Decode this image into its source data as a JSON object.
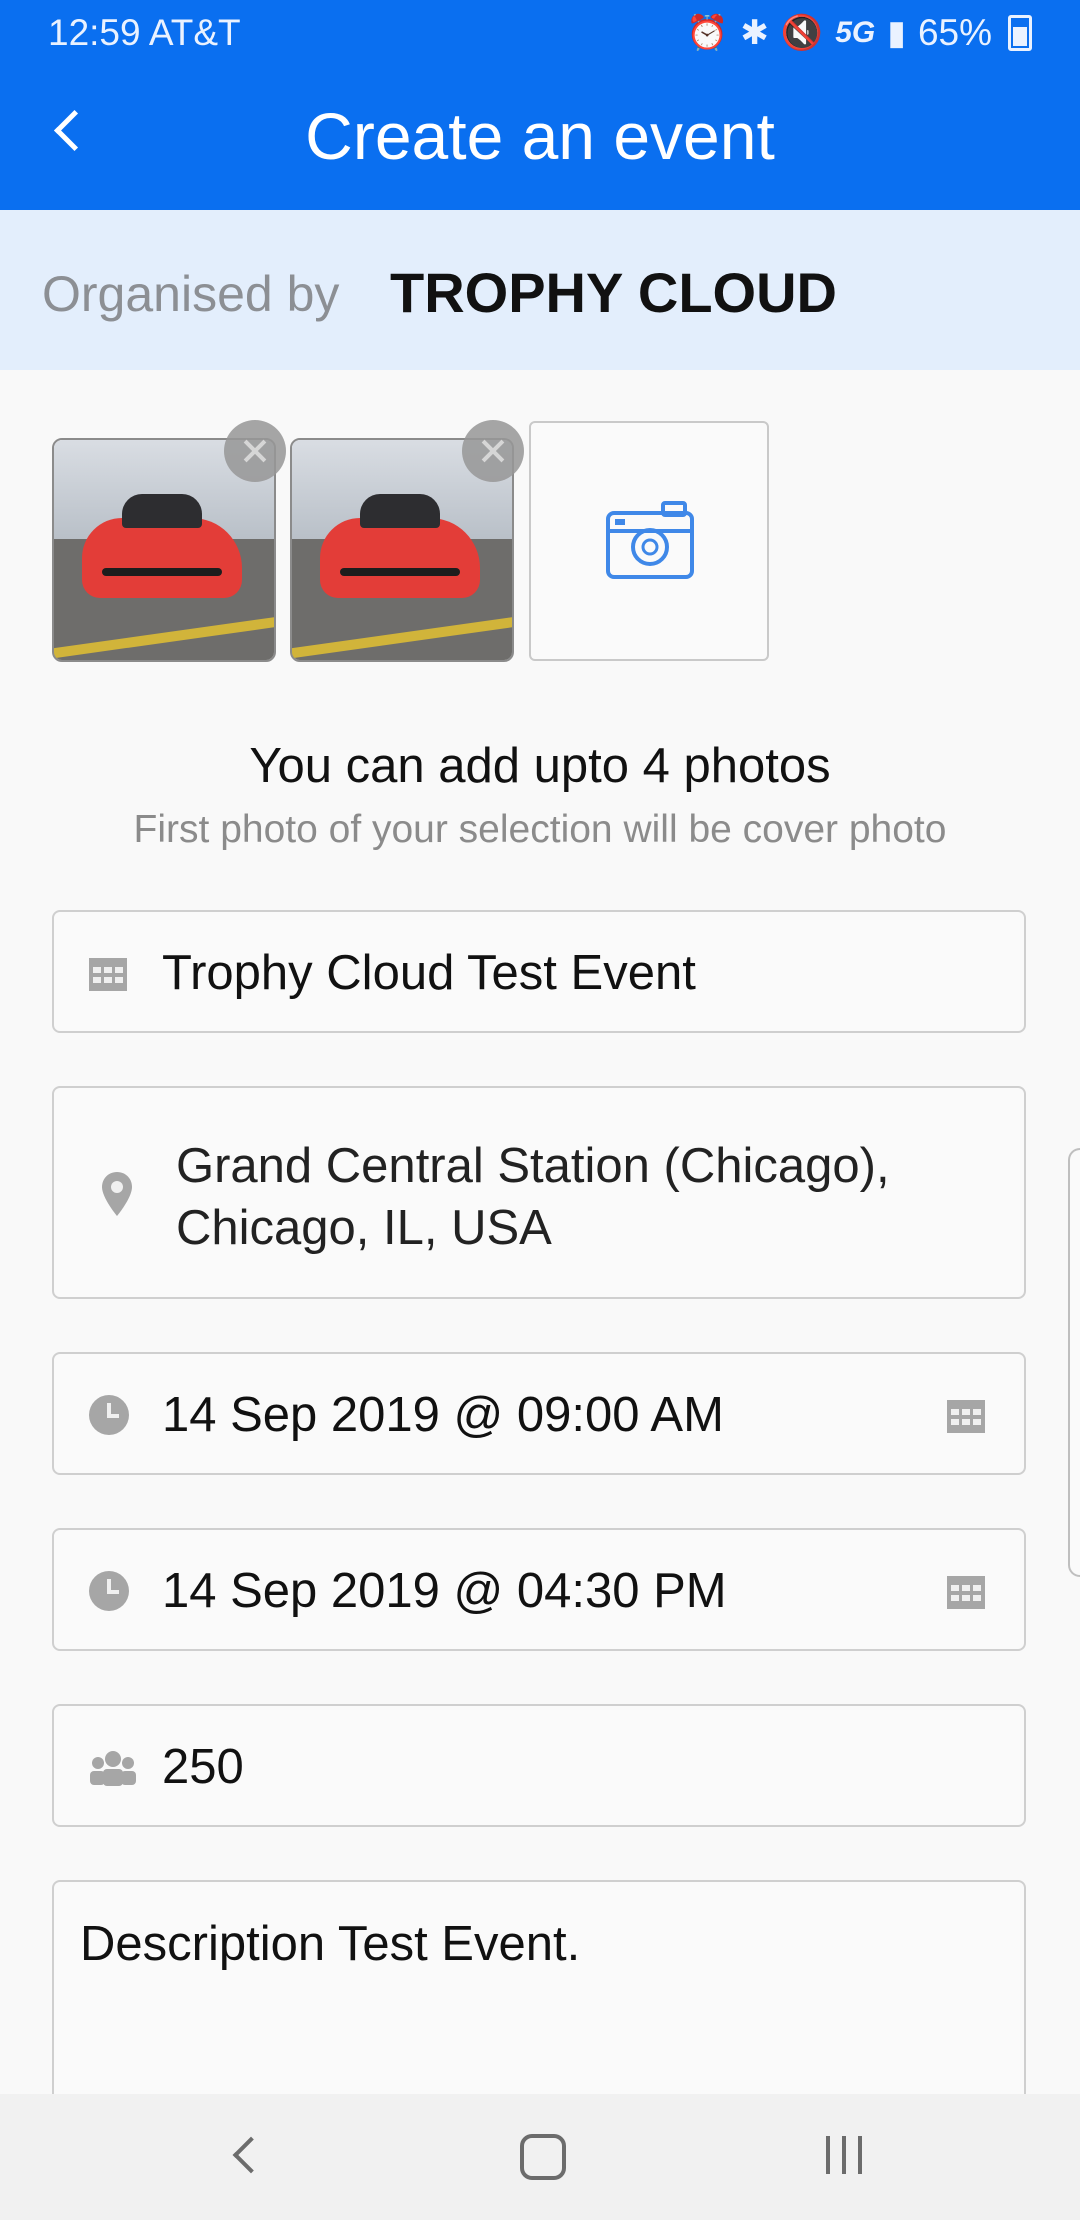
{
  "status_bar": {
    "time": "12:59",
    "carrier": "AT&T",
    "network": "5G",
    "battery": "65%"
  },
  "app_bar": {
    "title": "Create an event"
  },
  "organiser": {
    "label": "Organised by",
    "name": "TROPHY CLOUD"
  },
  "photos": {
    "count": 2,
    "note": "You can add upto 4 photos",
    "sub": "First photo of your selection will be cover photo"
  },
  "form": {
    "event_name": "Trophy Cloud Test Event",
    "location_line1": "Grand Central Station (Chicago),",
    "location_line2": "Chicago, IL, USA",
    "start": "14 Sep 2019 @ 09:00 AM",
    "end": "14 Sep 2019 @ 04:30 PM",
    "capacity": "250",
    "description": "Description Test Event."
  },
  "colors": {
    "primary": "#0a6ff0",
    "band": "#e3eefc",
    "icon_gray": "#9a9a9a"
  },
  "icons": [
    "back-icon",
    "alarm-icon",
    "bluetooth-icon",
    "mute-icon",
    "signal-icon",
    "battery-icon",
    "camera-icon",
    "calendar-icon",
    "location-pin-icon",
    "clock-icon",
    "people-icon",
    "close-icon"
  ]
}
